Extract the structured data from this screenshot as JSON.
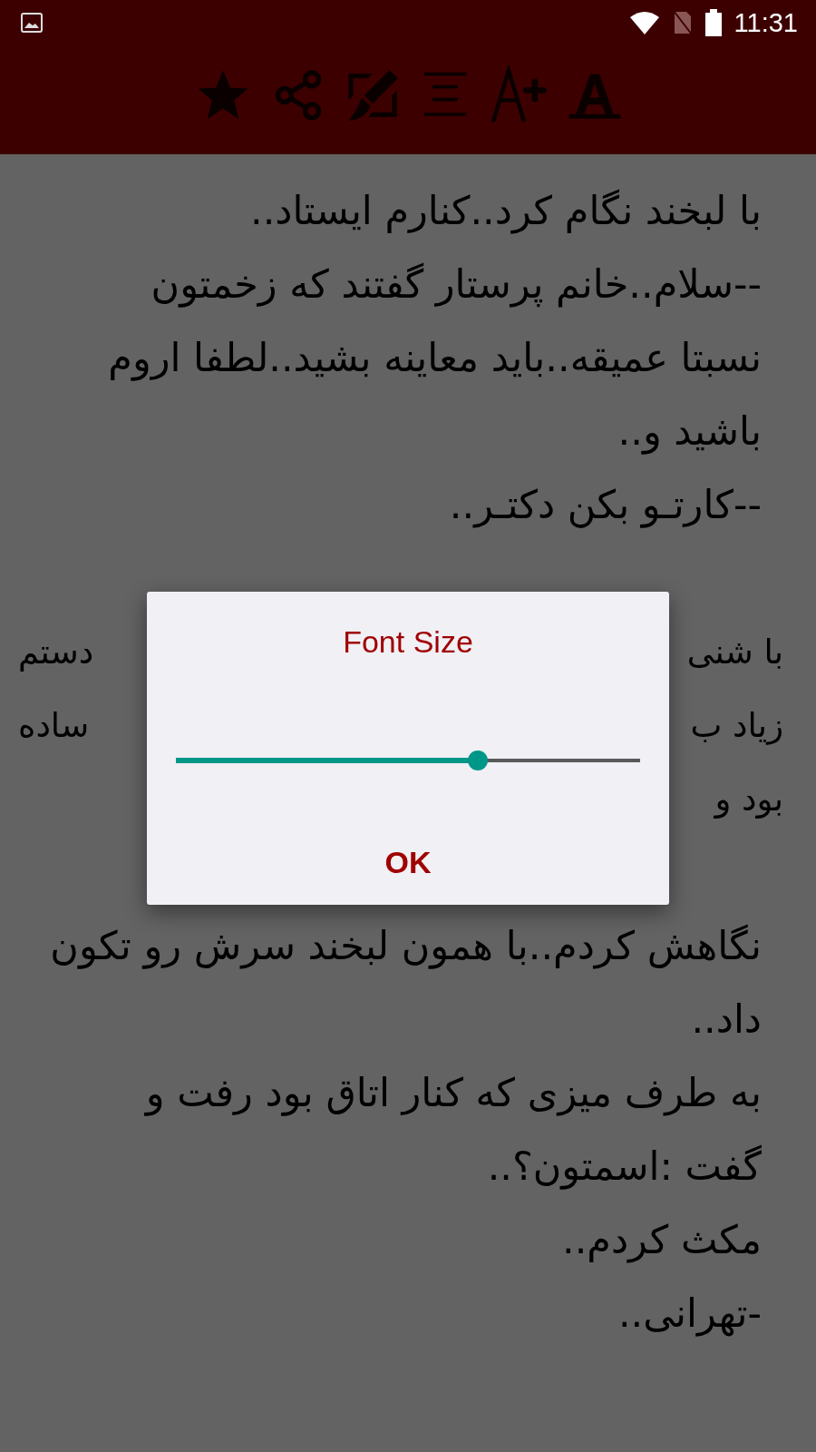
{
  "status_bar": {
    "time": "11:31"
  },
  "toolbar": {
    "actions": [
      {
        "kind": "star"
      },
      {
        "kind": "share"
      },
      {
        "kind": "edit"
      },
      {
        "kind": "align"
      },
      {
        "kind": "font_increase"
      },
      {
        "kind": "font"
      }
    ]
  },
  "content": {
    "lines": [
      {
        "kind": "text",
        "text": "با لبخند نگام کرد..کنارم ایستاد.."
      },
      {
        "kind": "text",
        "text": "--سلام..خانم پرستار گفتند که زخمتون"
      },
      {
        "kind": "text",
        "text": "نسبتا عمیقه..باید معاینه بشید..لطفا اروم"
      },
      {
        "kind": "text",
        "text": "باشید و.."
      },
      {
        "kind": "text",
        "text": "--کارتـو بکن دکتـر.."
      },
      {
        "kind": "blank"
      },
      {
        "kind": "split",
        "start": "با شنی",
        "end": "دستم"
      },
      {
        "kind": "split",
        "start": "زیاد ب",
        "end": "ساده"
      },
      {
        "kind": "split",
        "start": "بود و"
      },
      {
        "kind": "blank"
      },
      {
        "kind": "text",
        "text": "نگاهش کردم..با همون لبخند سرش رو تکون"
      },
      {
        "kind": "text",
        "text": "داد.."
      },
      {
        "kind": "text",
        "text": "به طرف میزی که کنار اتاق بود رفت و"
      },
      {
        "kind": "text",
        "text": "گفت :اسمتون؟.."
      },
      {
        "kind": "text",
        "text": "مکث کردم.."
      },
      {
        "kind": "text",
        "text": "-تهرانی.."
      }
    ]
  },
  "dialog": {
    "title": "Font Size",
    "slider": {
      "level": 0.65
    },
    "button": "OK"
  }
}
